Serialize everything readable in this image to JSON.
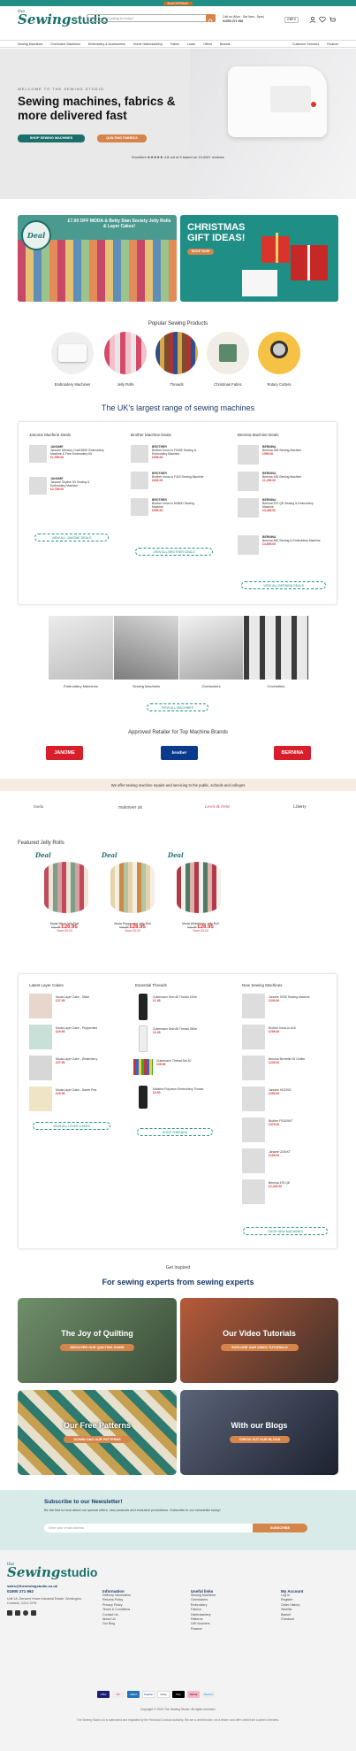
{
  "topbar": {
    "promo": "BLACKFRIDAY",
    "left": "",
    "right": ""
  },
  "header": {
    "logo_the": "the",
    "logo_sewing": "Sewing",
    "logo_studio": "studio",
    "search_placeholder": "What are you looking for today?",
    "contact_line1": "Call us (Mon - Sat 9am - 5pm)",
    "contact_line2": "01900 271 962",
    "currency": "GBP £"
  },
  "nav": {
    "items": [
      "Sewing Machines",
      "Overlocker Machines",
      "Embroidery & Accessories",
      "Home Haberdashery",
      "Fabric",
      "Learn",
      "Offers",
      "Brands"
    ],
    "right": [
      "Customer Services",
      "Finance"
    ]
  },
  "hero": {
    "kicker": "WELCOME TO THE SEWING STUDIO",
    "title": "Sewing machines, fabrics & more delivered fast",
    "btn_primary": "SHOP SEWING MACHINES",
    "btn_secondary": "QUILTING FABRICS",
    "rating": "Excellent ★★★★★ 4.8 out of 5 based on 10,000+ reviews"
  },
  "promo": {
    "left_heading": "£7.00 OFF MODA & Betty Stan Society Jelly Rolls & Layer Cakes!",
    "left_badge": "Deal",
    "right_heading": "CHRISTMAS GIFT IDEAS!",
    "right_btn": "SHOP NOW"
  },
  "popular": {
    "title": "Popular Sewing Products",
    "items": [
      "Embroidery Machines",
      "Jelly Rolls",
      "Threads",
      "Christmas Fabric",
      "Rotary Cutters"
    ]
  },
  "largest": {
    "title": "The UK's largest range of sewing machines",
    "columns": [
      {
        "title": "Janome Machine Deals",
        "items": [
          {
            "name": "JANOME",
            "desc": "Janome Memory Craft 550E Embroidery Machine & Free Embroidery Kit",
            "price": "£1,999.00"
          },
          {
            "name": "JANOME",
            "desc": "Janome Skyline S9 Sewing & Embroidery Machine",
            "price": "£2,799.00"
          }
        ],
        "button": "VIEW ALL JANOME DEALS"
      },
      {
        "title": "Brother Machine Deals",
        "items": [
          {
            "name": "BROTHER",
            "desc": "Brother Innov-is F540E Sewing & Embroidery Machine",
            "price": "£999.00"
          },
          {
            "name": "BROTHER",
            "desc": "Brother Innov-is F420 Sewing Machine",
            "price": "£649.00"
          },
          {
            "name": "BROTHER",
            "desc": "Brother Innov-is M380D Sewing Machine",
            "price": "£599.00"
          }
        ],
        "button": "VIEW ALL BROTHER DEALS"
      },
      {
        "title": "Bernina Machine Deals",
        "items": [
          {
            "name": "BERNINA",
            "desc": "Bernina 335 Sewing Machine",
            "price": "£999.00"
          },
          {
            "name": "BERNINA",
            "desc": "Bernina 435 Sewing Machine",
            "price": "£1,499.00"
          },
          {
            "name": "BERNINA",
            "desc": "Bernina 570 QE Sewing & Embroidery Machine",
            "price": "£3,499.00"
          },
          {
            "name": "BERNINA",
            "desc": "Bernina 590 Sewing & Embroidery Machine",
            "price": "£4,699.00"
          }
        ],
        "button": "VIEW ALL BERNINA DEALS"
      }
    ]
  },
  "machine_types": {
    "items": [
      "Embroidery Machines",
      "Sewing Machines",
      "Overlockers",
      "Coverstitch"
    ],
    "button": "VIEW ALL MACHINES"
  },
  "approved": {
    "title": "Approved Retailer for Top Machine Brands",
    "brands": [
      "JANOME",
      "brother",
      "BERNINA"
    ]
  },
  "notice": {
    "text": "We offer sewing machine repairs and servicing to the public, schools and colleges"
  },
  "fabric_brands": [
    "moda",
    "makower uk",
    "Lewis & Irene",
    "Liberty"
  ],
  "featured": {
    "title": "Featured Jelly Rolls",
    "items": [
      {
        "badge": "Deal",
        "name": "Moda Stitch Jelly Roll",
        "was": "£31.95",
        "price": "£26.95",
        "save": "Save £5.00"
      },
      {
        "badge": "Deal",
        "name": "Moda Peppermint Jelly Roll",
        "was": "£34.95",
        "price": "£28.95",
        "save": "Save £6.00"
      },
      {
        "badge": "Deal",
        "name": "Moda Winterberry Jelly Roll",
        "was": "£31.95",
        "price": "£26.95",
        "save": "Save £5.00"
      }
    ]
  },
  "lower": {
    "columns": [
      {
        "title": "Latest Layer Cakes",
        "items": [
          {
            "desc": "Moda Layer Cake - Stitch",
            "price": "£27.95"
          },
          {
            "desc": "Moda Layer Cake - Peppermint",
            "price": "£29.95"
          },
          {
            "desc": "Moda Layer Cake - Winterberry",
            "price": "£27.95"
          },
          {
            "desc": "Moda Layer Cake - Sweet Pea",
            "price": "£29.95"
          }
        ],
        "button": "VIEW ALL LAYER CAKES"
      },
      {
        "title": "Essential Threads",
        "items": [
          {
            "desc": "Gutermann Sew All Thread 100m",
            "price": "£1.95"
          },
          {
            "desc": "Gutermann Sew All Thread 250m",
            "price": "£3.35"
          },
          {
            "desc": "Gutermann Thread Set 30",
            "price": "£35.95"
          },
          {
            "desc": "Madeira Polyneon Embroidery Thread",
            "price": "£5.50"
          }
        ],
        "button": "SHOP THREADS"
      },
      {
        "title": "New Sewing Machines",
        "items": [
          {
            "desc": "Janome 525S Sewing Machine",
            "price": "£349.00"
          },
          {
            "desc": "Brother Innov-is A16",
            "price": "£299.00"
          },
          {
            "desc": "Bernina Bernette 05 Crafter",
            "price": "£249.00"
          },
          {
            "desc": "Janome HD2200",
            "price": "£299.00"
          },
          {
            "desc": "Brother FS100WT",
            "price": "£379.00"
          },
          {
            "desc": "Janome 2200XT",
            "price": "£199.00"
          },
          {
            "desc": "Bernina 475 QE",
            "price": "£2,499.00"
          }
        ],
        "button": "SHOP NEW MACHINES"
      }
    ]
  },
  "inspire": {
    "kicker": "Get Inspired",
    "title": "For sewing experts from sewing experts",
    "tiles": [
      {
        "title": "The Joy of Quilting",
        "btn": "DISCOVER OUR QUILTING GUIDE"
      },
      {
        "title": "Our Video Tutorials",
        "btn": "EXPLORE OUR VIDEO TUTORIALS"
      },
      {
        "title": "Our Free Patterns",
        "btn": "DOWNLOAD OUR PATTERNS"
      },
      {
        "title": "With our Blogs",
        "btn": "CHECK OUT OUR BLOGS"
      }
    ]
  },
  "newsletter": {
    "title": "Subscribe to our Newsletter!",
    "desc": "Be the first to hear about our special offers, new products and exclusive promotions. Subscribe to our newsletter today!",
    "placeholder": "Enter your email address",
    "btn": "SUBSCRIBE"
  },
  "footer": {
    "email": "sales@thesewingstudio.co.uk",
    "phone": "01900 271 962",
    "address": "Unit 1A, Derwent Howe Industrial Estate, Workington, Cumbria, CA14 3YW",
    "col1": {
      "title": "Information",
      "links": [
        "Delivery Information",
        "Returns Policy",
        "Privacy Policy",
        "Terms & Conditions",
        "Contact Us",
        "About Us",
        "Our Blog"
      ]
    },
    "col2": {
      "title": "Useful links",
      "links": [
        "Sewing Machines",
        "Overlockers",
        "Embroidery",
        "Fabrics",
        "Haberdashery",
        "Patterns",
        "Gift Vouchers",
        "Finance"
      ]
    },
    "col3": {
      "title": "My Account",
      "links": [
        "Log In",
        "Register",
        "Order History",
        "Wishlist",
        "Basket",
        "Checkout"
      ]
    },
    "payments": [
      "VISA",
      "MC",
      "AMEX",
      "PayPal",
      "GPay",
      "Pay",
      "Klarna",
      "Maestro"
    ],
    "copyright": "Copyright © 2024 The Sewing Studio. All rights reserved.",
    "legal": "The Sewing Studio Ltd is authorised and regulated by the Financial Conduct Authority. We are a credit broker, not a lender, and offer credit from a panel of lenders."
  },
  "colors": {
    "teal": "#1a6f6a",
    "orange": "#d5844a",
    "red": "#d33333",
    "navy": "#1a3a6a"
  }
}
